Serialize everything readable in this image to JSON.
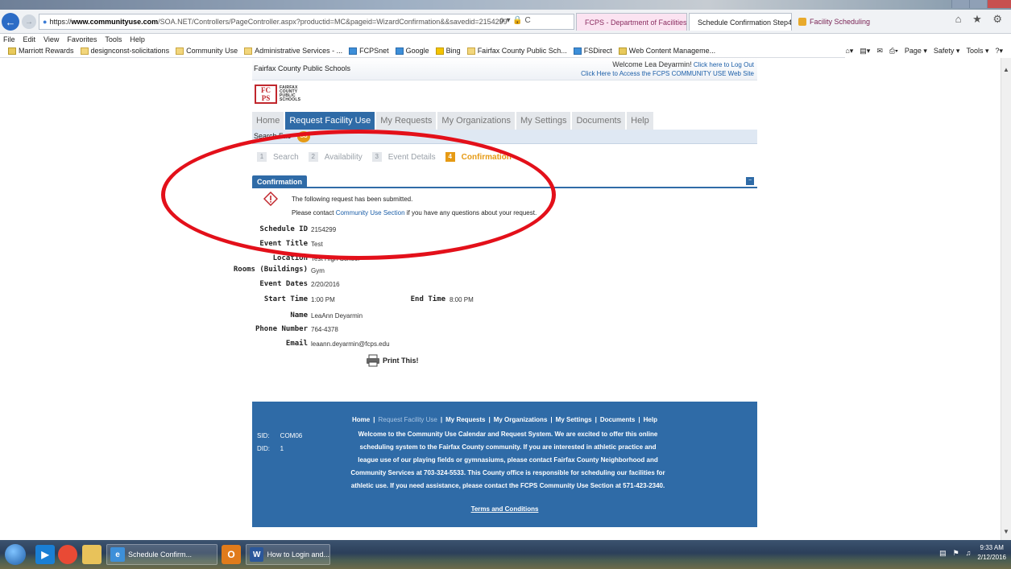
{
  "browser": {
    "url_scheme": "https://",
    "url_host": "www.communityuse.com",
    "url_path": "/SOA.NET/Controllers/PageController.aspx?productid=MC&pageid=WizardConfirmation&&savedid=2154299",
    "address_tools": "ρ ▾ 🔒 C",
    "tabs": [
      {
        "label": "FCPS - Department of Facilities..."
      },
      {
        "label": "Schedule Confirmation Step4 ×"
      },
      {
        "label": "Facility Scheduling"
      }
    ],
    "chrome_icons": "⌂ ★ ⚙",
    "menu": [
      "File",
      "Edit",
      "View",
      "Favorites",
      "Tools",
      "Help"
    ],
    "favorites": [
      {
        "label": "Marriott Rewards",
        "icon": "marriott-icon"
      },
      {
        "label": "designconst-solicitations",
        "icon": "folder-icon"
      },
      {
        "label": "Community Use",
        "icon": "folder-icon"
      },
      {
        "label": "Administrative Services - ...",
        "icon": "folder-icon"
      },
      {
        "label": "FCPSnet",
        "icon": "fcps-icon"
      },
      {
        "label": "Google",
        "icon": "google-icon"
      },
      {
        "label": "Bing",
        "icon": "bing-icon"
      },
      {
        "label": "Fairfax County Public Sch...",
        "icon": "folder-icon"
      },
      {
        "label": "FSDirect",
        "icon": "page-icon"
      },
      {
        "label": "Web Content Manageme...",
        "icon": "page-icon"
      }
    ],
    "command_bar": [
      "Page ▾",
      "Safety ▾",
      "Tools ▾",
      "?▾"
    ]
  },
  "site": {
    "school_name": "Fairfax County Public Schools",
    "welcome_text": "Welcome Lea Deyarmin!",
    "logout_link": "Click here to Log Out",
    "community_link": "Click Here to Access the FCPS COMMUNITY USE Web Site",
    "logo_mark_top": "FC",
    "logo_mark_bottom": "PS",
    "logo_text": "FAIRFAX COUNTY PUBLIC SCHOOLS",
    "tabs": [
      {
        "label": "Home",
        "active": false
      },
      {
        "label": "Request Facility Use",
        "active": true
      },
      {
        "label": "My Requests",
        "active": false
      },
      {
        "label": "My Organizations",
        "active": false
      },
      {
        "label": "My Settings",
        "active": false
      },
      {
        "label": "Documents",
        "active": false
      },
      {
        "label": "Help",
        "active": false
      }
    ],
    "search_label": "Search Fac",
    "search_go": "GO",
    "steps": [
      {
        "num": "1",
        "label": "Search"
      },
      {
        "num": "2",
        "label": "Availability"
      },
      {
        "num": "3",
        "label": "Event Details"
      },
      {
        "num": "4",
        "label": "Confirmation"
      }
    ]
  },
  "confirmation": {
    "panel_title": "Confirmation",
    "collapse": "−",
    "message_submitted": "The following request has been submitted.",
    "message_contact_prefix": "Please contact ",
    "message_contact_link": "Community Use Section",
    "message_contact_suffix": " if you have any questions about your request.",
    "fields": {
      "schedule_id": {
        "label": "Schedule ID",
        "value": "2154299"
      },
      "event_title": {
        "label": "Event Title",
        "value": "Test"
      },
      "location": {
        "label": "Location",
        "value": "Test High School"
      },
      "rooms": {
        "label": "Rooms (Buildings)",
        "value": "Gym"
      },
      "event_dates": {
        "label": "Event Dates",
        "value": "2/20/2016"
      },
      "start_time": {
        "label": "Start Time",
        "value": "1:00 PM"
      },
      "end_time": {
        "label": "End Time",
        "value": "8:00 PM"
      },
      "name": {
        "label": "Name",
        "value": "LeaAnn Deyarmin"
      },
      "phone": {
        "label": "Phone Number",
        "value": "764-4378"
      },
      "email": {
        "label": "Email",
        "value": "leaann.deyarmin@fcps.edu"
      }
    },
    "print_label": "Print This!"
  },
  "footer": {
    "links": [
      {
        "label": "Home",
        "dim": false
      },
      {
        "label": "Request Facility Use",
        "dim": true
      },
      {
        "label": "My Requests",
        "dim": false
      },
      {
        "label": "My Organizations",
        "dim": false
      },
      {
        "label": "My Settings",
        "dim": false
      },
      {
        "label": "Documents",
        "dim": false
      },
      {
        "label": "Help",
        "dim": false
      }
    ],
    "separator": "|",
    "sid_label": "SID:",
    "sid_value": "COM06",
    "did_label": "DID:",
    "did_value": "1",
    "welcome_text": "Welcome to the Community Use Calendar and Request System. We are excited to offer this online scheduling system to the Fairfax County community. If you are interested in athletic practice and league use of our playing fields or gymnasiums, please contact Fairfax County Neighborhood and Community Services at 703-324-5533. This County office is responsible for scheduling our facilities for athletic use. If you need assistance, please contact the FCPS Community Use Section at 571-423-2340.",
    "terms": "Terms and Conditions"
  },
  "taskbar": {
    "tasks": [
      {
        "label": "Schedule Confirm..."
      },
      {
        "label": "How to Login and..."
      }
    ],
    "time": "9:33 AM",
    "date": "2/12/2016"
  },
  "colors": {
    "brand_blue": "#2f6ba7",
    "step_orange": "#e69a14",
    "annotation_red": "#e3101a",
    "logo_red": "#c1272d"
  }
}
